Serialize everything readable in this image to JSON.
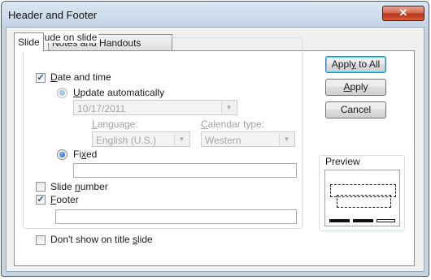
{
  "window": {
    "title": "Header and Footer",
    "close_glyph": "✕"
  },
  "tabs": [
    {
      "label": "Slide",
      "active": true
    },
    {
      "label": "Notes and Handouts",
      "active": false
    }
  ],
  "include_group": {
    "label": "Include on slide"
  },
  "date_time": {
    "label_pre": "",
    "label_key": "D",
    "label_post": "ate and time",
    "checked": true,
    "update_auto": {
      "label_pre": "",
      "label_key": "U",
      "label_post": "pdate automatically",
      "selected": false
    },
    "date_value": "10/17/2011",
    "language": {
      "label_pre": "",
      "label_key": "L",
      "label_post": "anguage:",
      "value": "English (U.S.)"
    },
    "calendar": {
      "label_pre": "",
      "label_key": "C",
      "label_post": "alendar type:",
      "value": "Western"
    },
    "fixed": {
      "label_pre": "Fi",
      "label_key": "x",
      "label_post": "ed",
      "selected": true,
      "value": ""
    }
  },
  "slide_number": {
    "label_pre": "Slide ",
    "label_key": "n",
    "label_post": "umber",
    "checked": false
  },
  "footer": {
    "label_pre": "",
    "label_key": "F",
    "label_post": "ooter",
    "checked": true,
    "value": ""
  },
  "dont_show_title": {
    "label_pre": "Don't show on title ",
    "label_key": "s",
    "label_post": "lide",
    "checked": false
  },
  "buttons": {
    "apply_all": {
      "pre": "Appl",
      "key": "y",
      "post": " to All"
    },
    "apply": {
      "pre": "",
      "key": "A",
      "post": "pply"
    },
    "cancel": {
      "label": "Cancel"
    }
  },
  "preview": {
    "label": "Preview"
  },
  "icons": {
    "check": "✓",
    "dropdown": "▼"
  }
}
